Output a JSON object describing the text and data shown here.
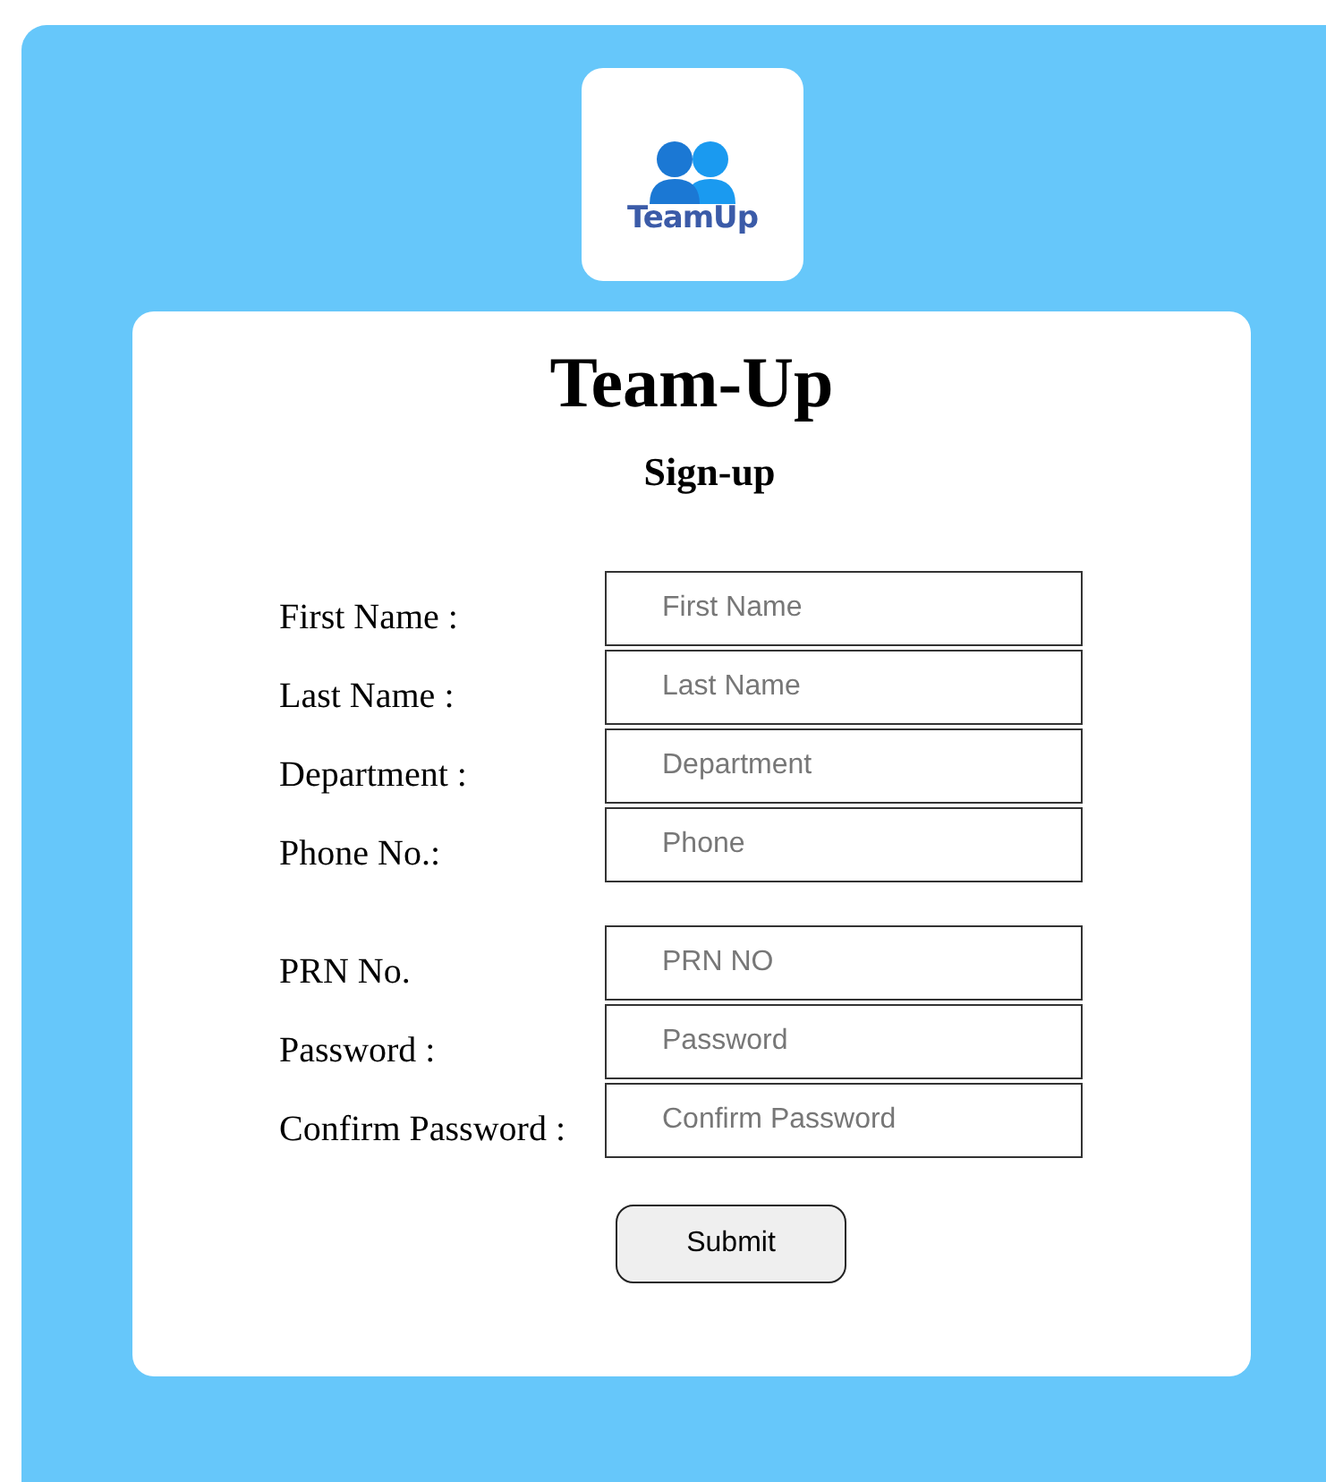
{
  "logo": {
    "text": "TeamUp"
  },
  "title": "Team-Up",
  "subtitle": "Sign-up",
  "field_groups": [
    [
      {
        "label": "First Name :",
        "placeholder": "First Name"
      },
      {
        "label": "Last Name :",
        "placeholder": "Last Name"
      },
      {
        "label": "Department :",
        "placeholder": "Department"
      },
      {
        "label": "Phone No.:",
        "placeholder": "Phone"
      }
    ],
    [
      {
        "label": "PRN No.",
        "placeholder": "PRN NO"
      },
      {
        "label": "Password :",
        "placeholder": "Password"
      },
      {
        "label": "Confirm Password :",
        "placeholder": "Confirm Password"
      }
    ]
  ],
  "submit_button": "Submit"
}
